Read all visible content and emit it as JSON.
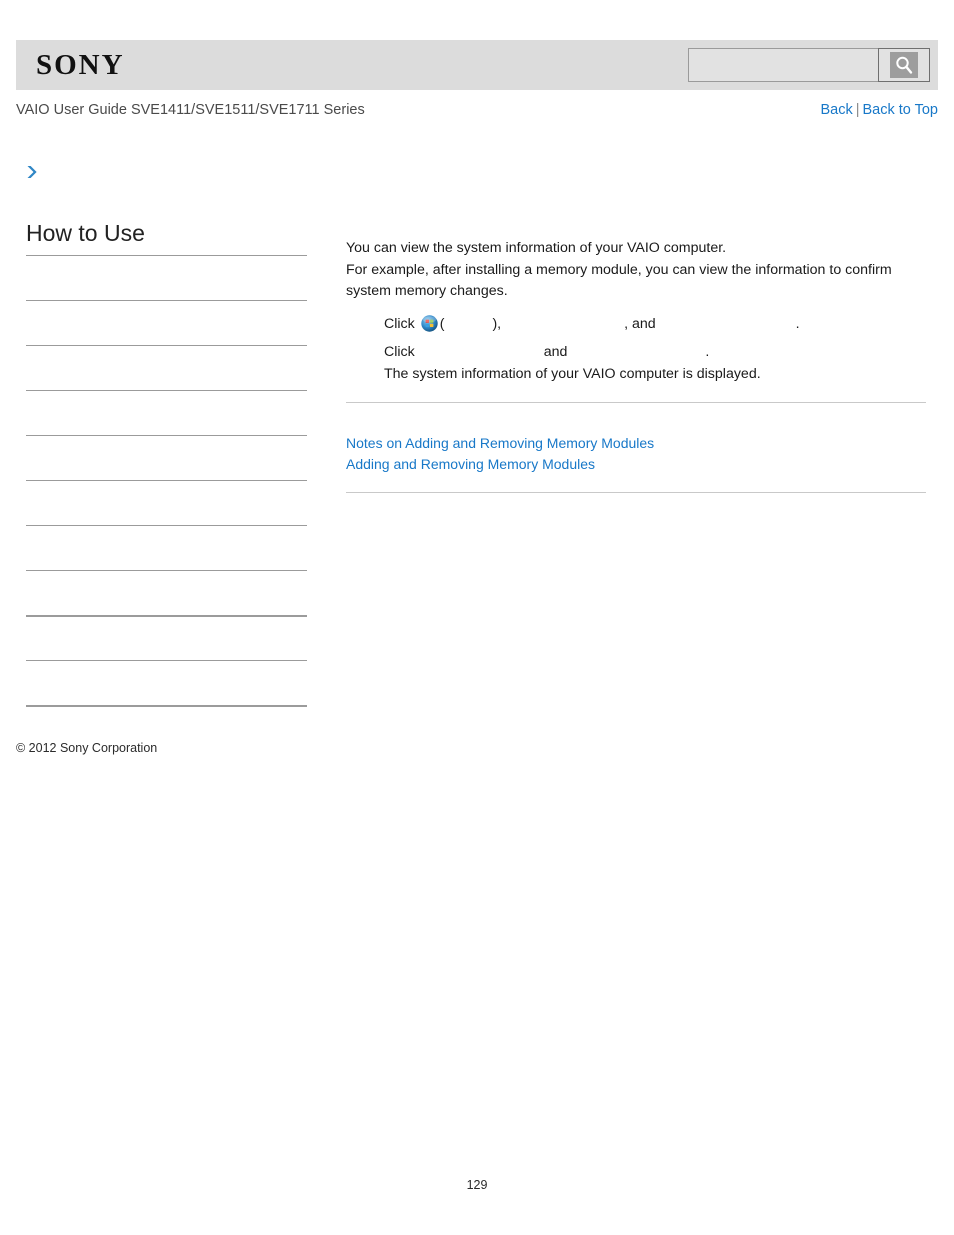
{
  "header": {
    "logo_text": "SONY",
    "search": {
      "value": "",
      "placeholder": "",
      "icon": "search-icon",
      "button_label": ""
    }
  },
  "title_bar": {
    "guide_title": "VAIO User Guide SVE1411/SVE1511/SVE1711 Series",
    "back_label": "Back",
    "separator": "|",
    "back_to_top_label": "Back to Top"
  },
  "breadcrumb": {
    "arrow_icon": "chevron-right-icon",
    "text": ""
  },
  "sidebar": {
    "heading": "How to Use",
    "items": [
      {
        "label": "",
        "thick": false
      },
      {
        "label": "",
        "thick": false
      },
      {
        "label": "",
        "thick": false
      },
      {
        "label": "",
        "thick": false
      },
      {
        "label": "",
        "thick": false
      },
      {
        "label": "",
        "thick": false
      },
      {
        "label": "",
        "thick": false
      },
      {
        "label": "",
        "thick": false
      },
      {
        "label": "",
        "thick": true
      },
      {
        "label": "",
        "thick": false
      },
      {
        "label": "",
        "thick": true
      }
    ]
  },
  "content": {
    "paragraph_1": "You can view the system information of your VAIO computer.",
    "paragraph_2": "For example, after installing a memory module, you can view the information to confirm system memory changes.",
    "steps": [
      {
        "prefix": "Click",
        "icon": "windows-start-orb-icon",
        "open_paren": "(",
        "slot_1": "",
        "close_paren": "),",
        "slot_2": "",
        "conjunction": ", and",
        "slot_3": "",
        "period": "."
      },
      {
        "prefix": "Click",
        "slot_1": "",
        "conjunction": "and",
        "slot_2": "",
        "period": "."
      },
      {
        "text": "The system information of your VAIO computer is displayed."
      }
    ]
  },
  "related_links": [
    "Notes on Adding and Removing Memory Modules",
    "Adding and Removing Memory Modules"
  ],
  "footer": {
    "copyright": "© 2012 Sony Corporation",
    "page_number": "129"
  },
  "colors": {
    "link": "#1878c8",
    "header_band": "#dcdcdc",
    "rule": "#c9c9c9",
    "sidebar_rule": "#9b9b9b"
  }
}
